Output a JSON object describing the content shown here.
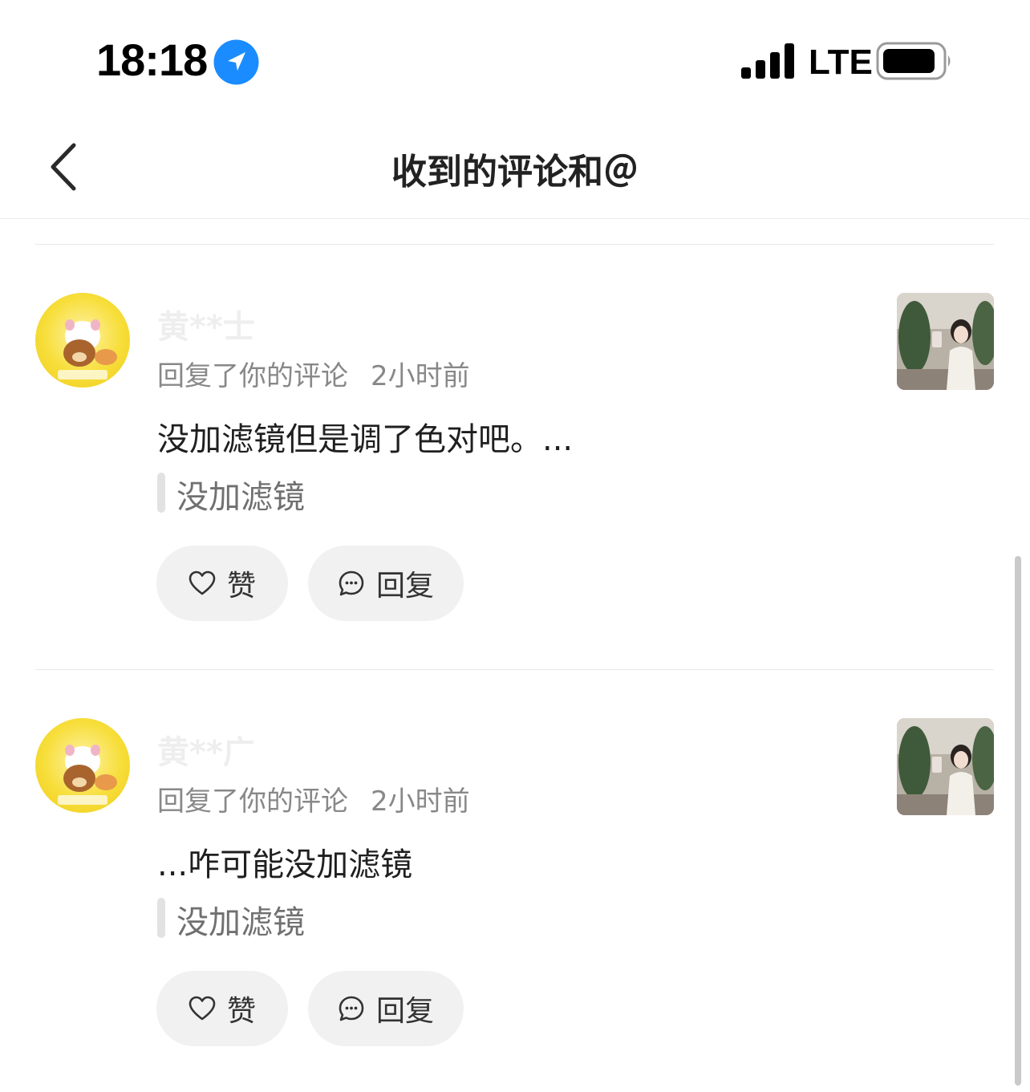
{
  "status_bar": {
    "time": "18:18",
    "network": "LTE",
    "icons": [
      "location-arrow-icon",
      "signal-bars-icon",
      "battery-icon"
    ],
    "location_icon_color": "#1a8cff"
  },
  "nav": {
    "title": "收到的评论和＠",
    "back_icon": "chevron-left-icon"
  },
  "comments": [
    {
      "username": "黄**士",
      "action": "回复了你的评论",
      "time_ago": "2小时前",
      "text": "没加滤镜但是调了色对吧。...",
      "quoted": "没加滤镜",
      "like_label": "赞",
      "reply_label": "回复"
    },
    {
      "username": "黄**广",
      "action": "回复了你的评论",
      "time_ago": "2小时前",
      "text": "...咋可能没加滤镜",
      "quoted": "没加滤镜",
      "like_label": "赞",
      "reply_label": "回复"
    }
  ]
}
